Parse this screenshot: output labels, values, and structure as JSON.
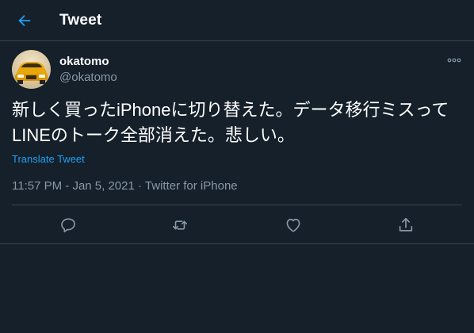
{
  "header": {
    "title": "Tweet",
    "back_icon": "arrow-left-icon"
  },
  "tweet": {
    "author": {
      "display_name": "okatomo",
      "handle": "@okatomo",
      "avatar_icon": "car-avatar"
    },
    "more_icon": "more-dots-icon",
    "text": "新しく買ったiPhoneに切り替えた。データ移行ミスってLINEのトーク全部消えた。悲しい。",
    "translate_label": "Translate Tweet",
    "time": "11:57 PM",
    "date": "Jan 5, 2021",
    "separator": "·",
    "source": "Twitter for iPhone"
  },
  "actions": [
    {
      "name": "reply",
      "icon": "reply-icon"
    },
    {
      "name": "retweet",
      "icon": "retweet-icon"
    },
    {
      "name": "like",
      "icon": "heart-icon"
    },
    {
      "name": "share",
      "icon": "share-icon"
    }
  ],
  "colors": {
    "background": "#15202b",
    "accent": "#1da1f2",
    "secondary_text": "#8899a6",
    "border": "#38444d"
  }
}
